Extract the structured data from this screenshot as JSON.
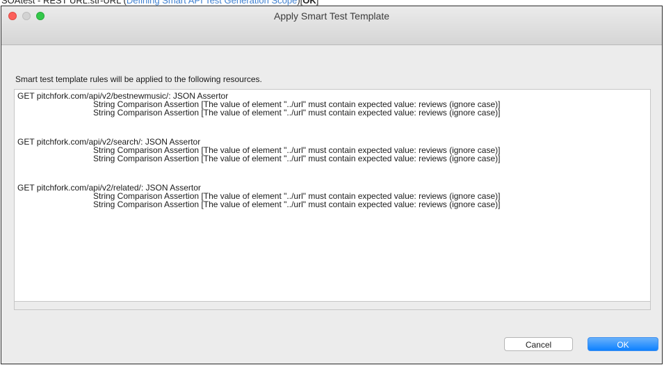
{
  "page_strip": {
    "prefix": "SOAtest - REST URL:str-URL (",
    "link": "Defining Smart API Test Generation Scope",
    "suffix": ")[",
    "bold": "OK",
    "end": "]"
  },
  "window": {
    "title": "Apply Smart Test Template"
  },
  "intro": "Smart test template rules will be applied to the following resources.",
  "resources": [
    {
      "header": "GET pitchfork.com/api/v2/bestnewmusic/: JSON Assertor",
      "assertions": [
        "String Comparison Assertion [The value of element \"../url\" must contain expected value: reviews (ignore case)]",
        "String Comparison Assertion [The value of element \"../url\" must contain expected value: reviews (ignore case)]"
      ]
    },
    {
      "header": "GET pitchfork.com/api/v2/search/: JSON Assertor",
      "assertions": [
        "String Comparison Assertion [The value of element \"../url\" must contain expected value: reviews (ignore case)]",
        "String Comparison Assertion [The value of element \"../url\" must contain expected value: reviews (ignore case)]"
      ]
    },
    {
      "header": "GET pitchfork.com/api/v2/related/: JSON Assertor",
      "assertions": [
        "String Comparison Assertion [The value of element \"../url\" must contain expected value: reviews (ignore case)]",
        "String Comparison Assertion [The value of element \"../url\" must contain expected value: reviews (ignore case)]"
      ]
    }
  ],
  "buttons": {
    "cancel": "Cancel",
    "ok": "OK"
  },
  "colors": {
    "ok_button": "#0d81ff",
    "close_light": "#fc605b",
    "zoom_light": "#34c84a",
    "link": "#3d7fd0"
  }
}
